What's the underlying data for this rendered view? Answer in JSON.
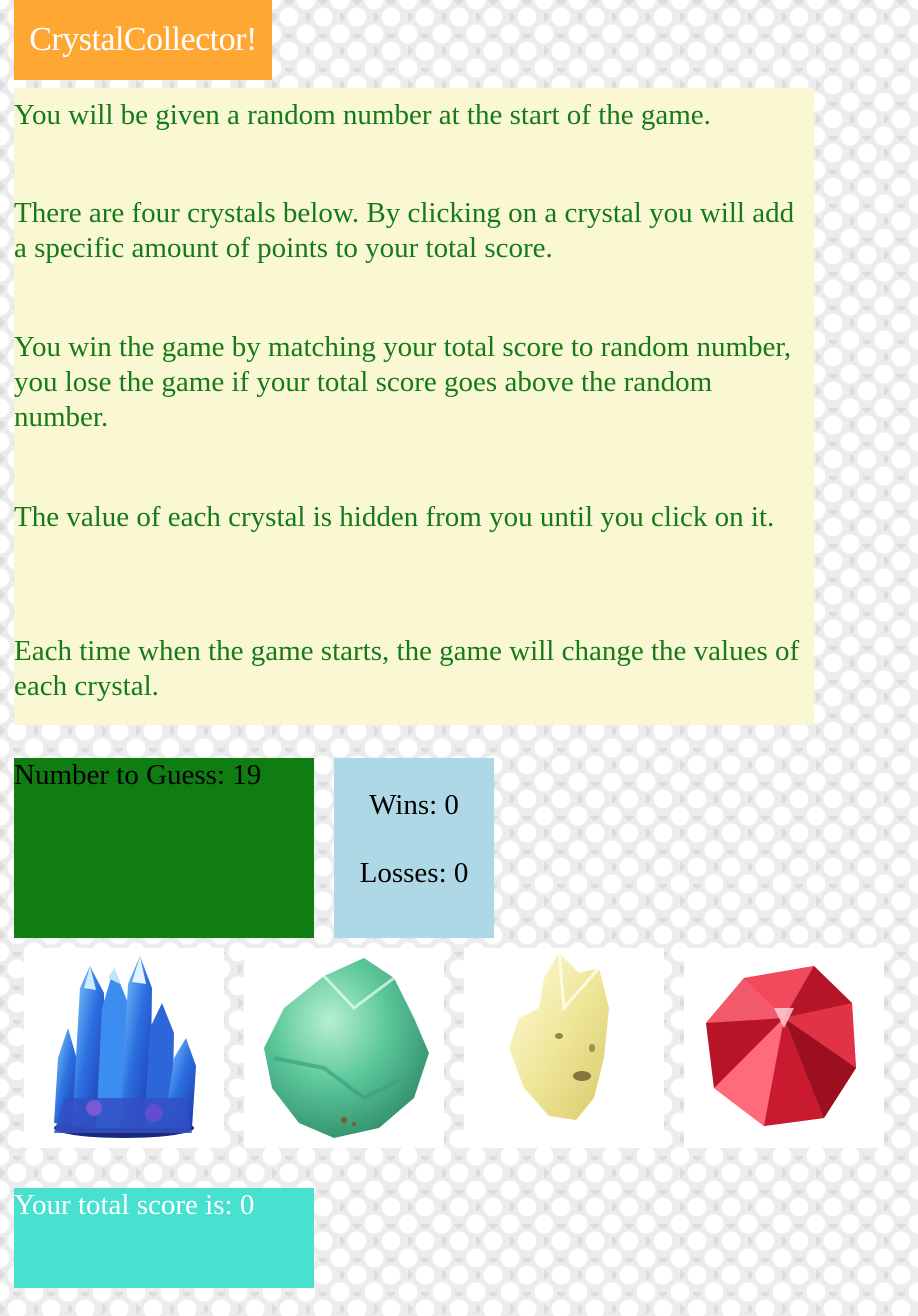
{
  "app": {
    "title": "CrystalCollector!"
  },
  "instructions": [
    "You will be given a random number at the start of the game.",
    "There are four crystals below. By clicking on a crystal you will add a specific amount of points to your total score.",
    "You win the game by matching your total score to random number, you lose the game if your total score goes above the random number.",
    "The value of each crystal is hidden from you until you click on it.",
    "Each time when the game starts, the game will change the values of each crystal."
  ],
  "game": {
    "number_to_guess_label": "Number to Guess: 19",
    "wins_label": "Wins: 0",
    "losses_label": "Losses: 0",
    "total_score_label": "Your total score is: 0"
  },
  "crystals": [
    {
      "name": "blue-crystal",
      "color": "#2a6fe0"
    },
    {
      "name": "green-crystal",
      "color": "#5cc79b"
    },
    {
      "name": "yellow-crystal",
      "color": "#efe79a"
    },
    {
      "name": "red-crystal",
      "color": "#d91f35"
    }
  ],
  "colors": {
    "title_bg": "#ffa733",
    "instructions_bg": "#faf8d2",
    "instructions_text": "#157a1b",
    "guess_bg": "#107d12",
    "stats_bg": "#afd8e6",
    "score_bg": "#48e0cf"
  }
}
